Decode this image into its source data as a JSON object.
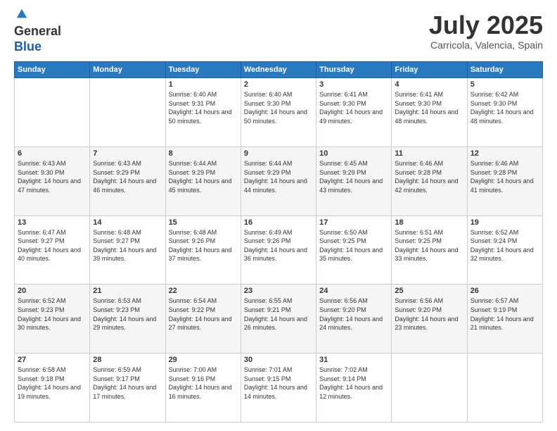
{
  "header": {
    "logo_line1": "General",
    "logo_line2": "Blue",
    "title": "July 2025",
    "location": "Carricola, Valencia, Spain"
  },
  "days_of_week": [
    "Sunday",
    "Monday",
    "Tuesday",
    "Wednesday",
    "Thursday",
    "Friday",
    "Saturday"
  ],
  "weeks": [
    [
      {
        "day": "",
        "sunrise": "",
        "sunset": "",
        "daylight": ""
      },
      {
        "day": "",
        "sunrise": "",
        "sunset": "",
        "daylight": ""
      },
      {
        "day": "1",
        "sunrise": "Sunrise: 6:40 AM",
        "sunset": "Sunset: 9:31 PM",
        "daylight": "Daylight: 14 hours and 50 minutes."
      },
      {
        "day": "2",
        "sunrise": "Sunrise: 6:40 AM",
        "sunset": "Sunset: 9:30 PM",
        "daylight": "Daylight: 14 hours and 50 minutes."
      },
      {
        "day": "3",
        "sunrise": "Sunrise: 6:41 AM",
        "sunset": "Sunset: 9:30 PM",
        "daylight": "Daylight: 14 hours and 49 minutes."
      },
      {
        "day": "4",
        "sunrise": "Sunrise: 6:41 AM",
        "sunset": "Sunset: 9:30 PM",
        "daylight": "Daylight: 14 hours and 48 minutes."
      },
      {
        "day": "5",
        "sunrise": "Sunrise: 6:42 AM",
        "sunset": "Sunset: 9:30 PM",
        "daylight": "Daylight: 14 hours and 48 minutes."
      }
    ],
    [
      {
        "day": "6",
        "sunrise": "Sunrise: 6:43 AM",
        "sunset": "Sunset: 9:30 PM",
        "daylight": "Daylight: 14 hours and 47 minutes."
      },
      {
        "day": "7",
        "sunrise": "Sunrise: 6:43 AM",
        "sunset": "Sunset: 9:29 PM",
        "daylight": "Daylight: 14 hours and 46 minutes."
      },
      {
        "day": "8",
        "sunrise": "Sunrise: 6:44 AM",
        "sunset": "Sunset: 9:29 PM",
        "daylight": "Daylight: 14 hours and 45 minutes."
      },
      {
        "day": "9",
        "sunrise": "Sunrise: 6:44 AM",
        "sunset": "Sunset: 9:29 PM",
        "daylight": "Daylight: 14 hours and 44 minutes."
      },
      {
        "day": "10",
        "sunrise": "Sunrise: 6:45 AM",
        "sunset": "Sunset: 9:29 PM",
        "daylight": "Daylight: 14 hours and 43 minutes."
      },
      {
        "day": "11",
        "sunrise": "Sunrise: 6:46 AM",
        "sunset": "Sunset: 9:28 PM",
        "daylight": "Daylight: 14 hours and 42 minutes."
      },
      {
        "day": "12",
        "sunrise": "Sunrise: 6:46 AM",
        "sunset": "Sunset: 9:28 PM",
        "daylight": "Daylight: 14 hours and 41 minutes."
      }
    ],
    [
      {
        "day": "13",
        "sunrise": "Sunrise: 6:47 AM",
        "sunset": "Sunset: 9:27 PM",
        "daylight": "Daylight: 14 hours and 40 minutes."
      },
      {
        "day": "14",
        "sunrise": "Sunrise: 6:48 AM",
        "sunset": "Sunset: 9:27 PM",
        "daylight": "Daylight: 14 hours and 39 minutes."
      },
      {
        "day": "15",
        "sunrise": "Sunrise: 6:48 AM",
        "sunset": "Sunset: 9:26 PM",
        "daylight": "Daylight: 14 hours and 37 minutes."
      },
      {
        "day": "16",
        "sunrise": "Sunrise: 6:49 AM",
        "sunset": "Sunset: 9:26 PM",
        "daylight": "Daylight: 14 hours and 36 minutes."
      },
      {
        "day": "17",
        "sunrise": "Sunrise: 6:50 AM",
        "sunset": "Sunset: 9:25 PM",
        "daylight": "Daylight: 14 hours and 35 minutes."
      },
      {
        "day": "18",
        "sunrise": "Sunrise: 6:51 AM",
        "sunset": "Sunset: 9:25 PM",
        "daylight": "Daylight: 14 hours and 33 minutes."
      },
      {
        "day": "19",
        "sunrise": "Sunrise: 6:52 AM",
        "sunset": "Sunset: 9:24 PM",
        "daylight": "Daylight: 14 hours and 32 minutes."
      }
    ],
    [
      {
        "day": "20",
        "sunrise": "Sunrise: 6:52 AM",
        "sunset": "Sunset: 9:23 PM",
        "daylight": "Daylight: 14 hours and 30 minutes."
      },
      {
        "day": "21",
        "sunrise": "Sunrise: 6:53 AM",
        "sunset": "Sunset: 9:23 PM",
        "daylight": "Daylight: 14 hours and 29 minutes."
      },
      {
        "day": "22",
        "sunrise": "Sunrise: 6:54 AM",
        "sunset": "Sunset: 9:22 PM",
        "daylight": "Daylight: 14 hours and 27 minutes."
      },
      {
        "day": "23",
        "sunrise": "Sunrise: 6:55 AM",
        "sunset": "Sunset: 9:21 PM",
        "daylight": "Daylight: 14 hours and 26 minutes."
      },
      {
        "day": "24",
        "sunrise": "Sunrise: 6:56 AM",
        "sunset": "Sunset: 9:20 PM",
        "daylight": "Daylight: 14 hours and 24 minutes."
      },
      {
        "day": "25",
        "sunrise": "Sunrise: 6:56 AM",
        "sunset": "Sunset: 9:20 PM",
        "daylight": "Daylight: 14 hours and 23 minutes."
      },
      {
        "day": "26",
        "sunrise": "Sunrise: 6:57 AM",
        "sunset": "Sunset: 9:19 PM",
        "daylight": "Daylight: 14 hours and 21 minutes."
      }
    ],
    [
      {
        "day": "27",
        "sunrise": "Sunrise: 6:58 AM",
        "sunset": "Sunset: 9:18 PM",
        "daylight": "Daylight: 14 hours and 19 minutes."
      },
      {
        "day": "28",
        "sunrise": "Sunrise: 6:59 AM",
        "sunset": "Sunset: 9:17 PM",
        "daylight": "Daylight: 14 hours and 17 minutes."
      },
      {
        "day": "29",
        "sunrise": "Sunrise: 7:00 AM",
        "sunset": "Sunset: 9:16 PM",
        "daylight": "Daylight: 14 hours and 16 minutes."
      },
      {
        "day": "30",
        "sunrise": "Sunrise: 7:01 AM",
        "sunset": "Sunset: 9:15 PM",
        "daylight": "Daylight: 14 hours and 14 minutes."
      },
      {
        "day": "31",
        "sunrise": "Sunrise: 7:02 AM",
        "sunset": "Sunset: 9:14 PM",
        "daylight": "Daylight: 14 hours and 12 minutes."
      },
      {
        "day": "",
        "sunrise": "",
        "sunset": "",
        "daylight": ""
      },
      {
        "day": "",
        "sunrise": "",
        "sunset": "",
        "daylight": ""
      }
    ]
  ]
}
